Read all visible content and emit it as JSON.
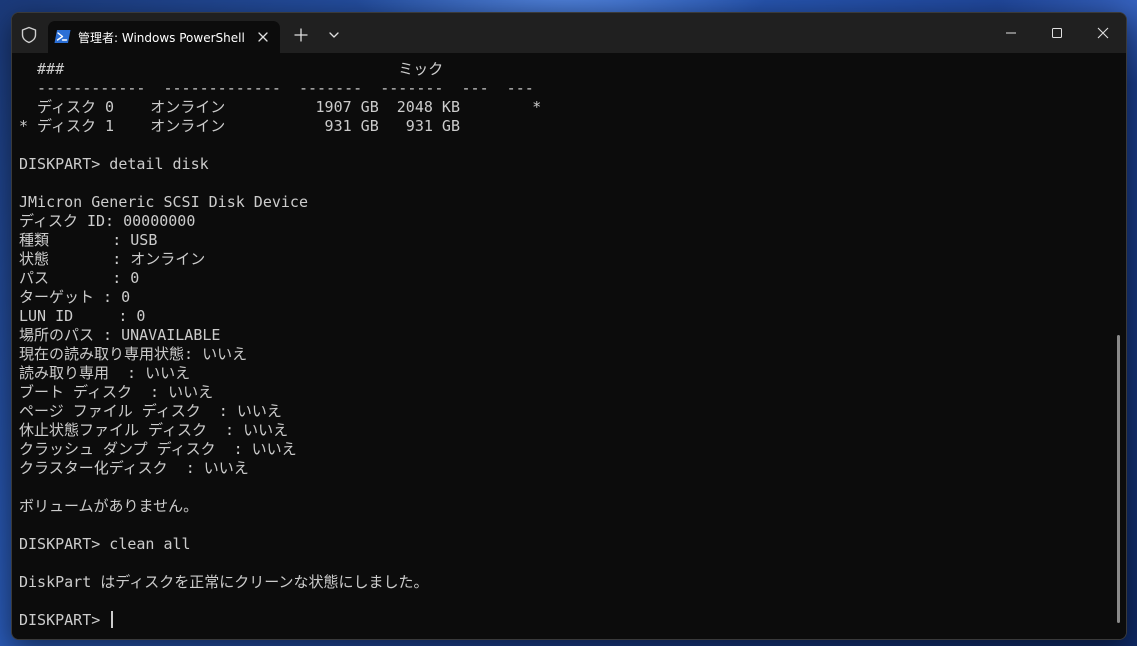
{
  "window": {
    "tab_title": "管理者: Windows PowerShell"
  },
  "icons": {
    "shield": "shield-icon",
    "powershell": "powershell-icon",
    "close_tab": "close-icon",
    "new_tab": "plus-icon",
    "dropdown": "chevron-down-icon",
    "minimize": "minimize-icon",
    "maximize": "maximize-icon",
    "close_window": "close-icon"
  },
  "colors": {
    "terminal_bg": "#0c0c0c",
    "terminal_fg": "#cccccc",
    "titlebar_bg": "#202020"
  },
  "terminal": {
    "lines": [
      "  ###                                     ミック",
      "  ------------  -------------  -------  -------  ---  ---",
      "  ディスク 0    オンライン          1907 GB  2048 KB        *",
      "* ディスク 1    オンライン           931 GB   931 GB",
      "",
      "DISKPART> detail disk",
      "",
      "JMicron Generic SCSI Disk Device",
      "ディスク ID: 00000000",
      "種類       : USB",
      "状態       : オンライン",
      "パス       : 0",
      "ターゲット : 0",
      "LUN ID     : 0",
      "場所のパス : UNAVAILABLE",
      "現在の読み取り専用状態: いいえ",
      "読み取り専用  : いいえ",
      "ブート ディスク  : いいえ",
      "ページ ファイル ディスク  : いいえ",
      "休止状態ファイル ディスク  : いいえ",
      "クラッシュ ダンプ ディスク  : いいえ",
      "クラスター化ディスク  : いいえ",
      "",
      "ボリュームがありません。",
      "",
      "DISKPART> clean all",
      "",
      "DiskPart はディスクを正常にクリーンな状態にしました。",
      ""
    ],
    "prompt": "DISKPART> "
  }
}
